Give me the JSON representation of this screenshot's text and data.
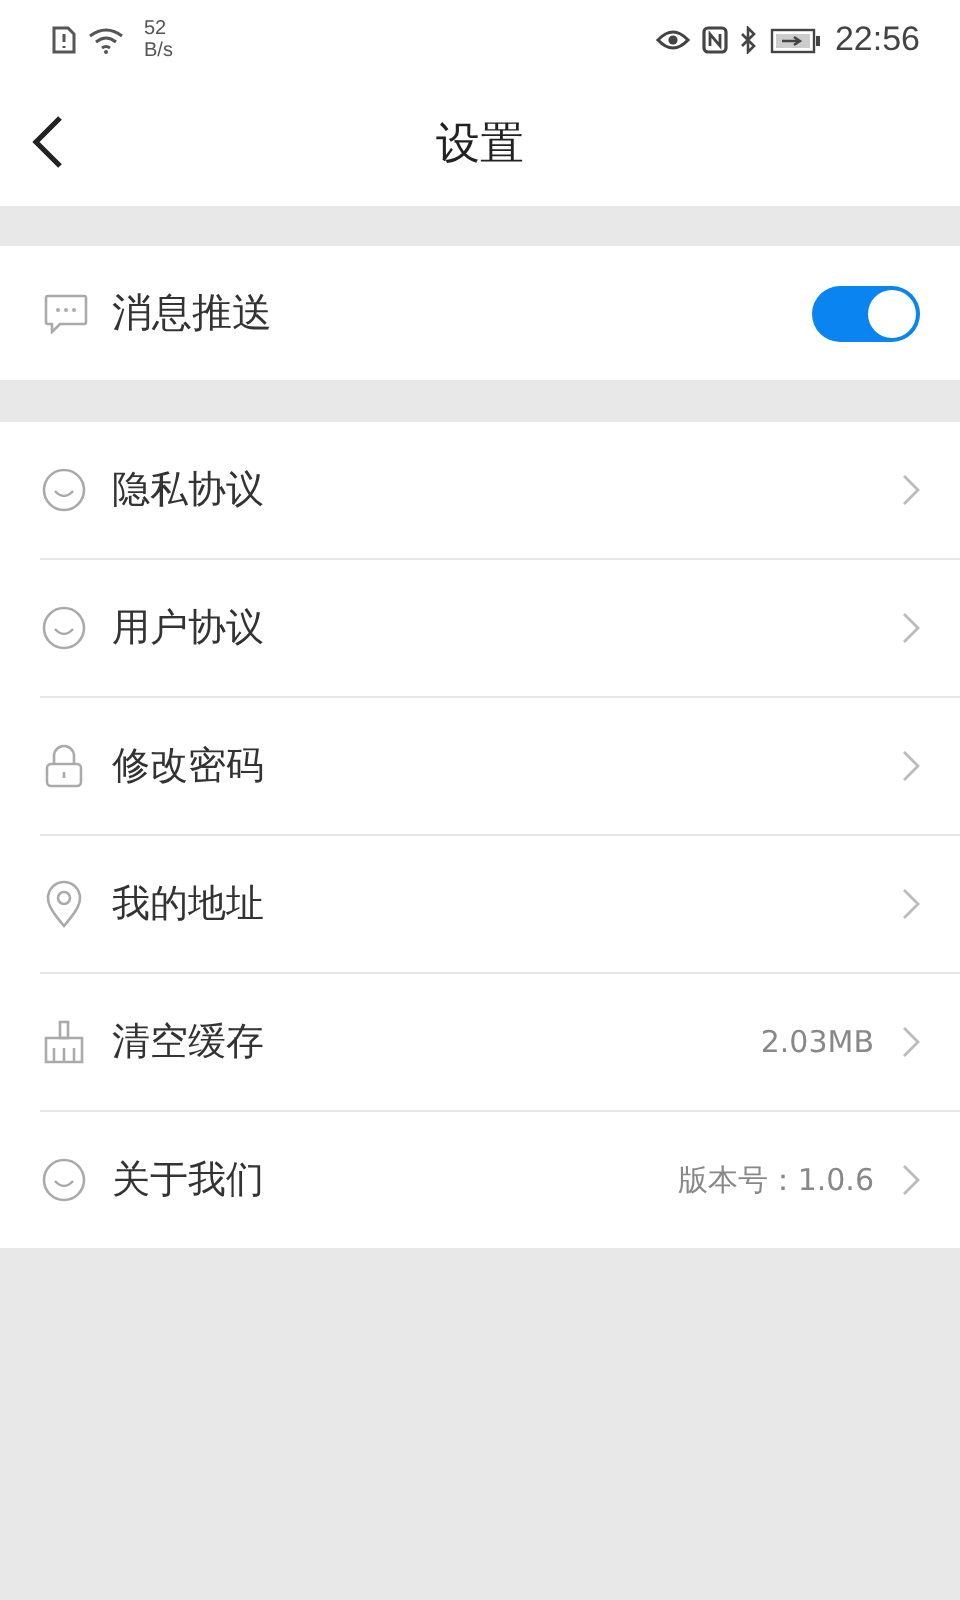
{
  "status_bar": {
    "net_speed_value": "52",
    "net_speed_unit": "B/s",
    "time": "22:56"
  },
  "header": {
    "title": "设置"
  },
  "push_section": {
    "kind": "chat",
    "label": "消息推送",
    "on": true
  },
  "items": [
    {
      "kind": "smile",
      "label": "隐私协议"
    },
    {
      "kind": "smile",
      "label": "用户协议"
    },
    {
      "kind": "lock",
      "label": "修改密码"
    },
    {
      "kind": "pin",
      "label": "我的地址"
    },
    {
      "kind": "broom",
      "label": "清空缓存",
      "value": "2.03MB"
    },
    {
      "kind": "smile",
      "label": "关于我们",
      "value": "版本号：1.0.6"
    }
  ]
}
